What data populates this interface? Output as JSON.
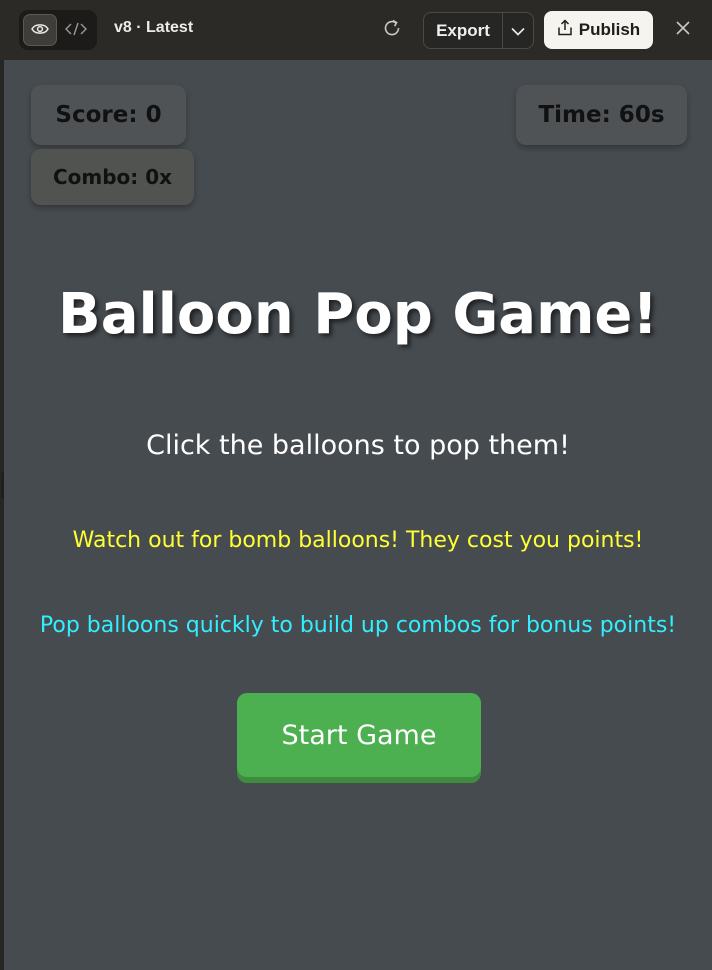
{
  "toolbar": {
    "version_label": "v8 · Latest",
    "export_label": "Export",
    "publish_label": "Publish",
    "icons": {
      "preview": "eye-icon",
      "code": "code-icon",
      "refresh": "refresh-icon",
      "export_menu": "chevron-down-icon",
      "publish": "share-icon",
      "close": "close-icon"
    }
  },
  "game": {
    "score_text": "Score: 0",
    "time_text": "Time: 60s",
    "combo_text": "Combo: 0x",
    "title": "Balloon Pop Game!",
    "instructions": [
      "Click the balloons to pop them!",
      "Watch out for bomb balloons! They cost you points!",
      "Pop balloons quickly to build up combos for bonus points!"
    ],
    "start_label": "Start Game",
    "colors": {
      "background": "#464b4f",
      "title": "#ffffff",
      "instruction_main": "#ffffff",
      "instruction_warning": "#ffff33",
      "instruction_tip": "#33eeff",
      "start_button": "#4caf50"
    }
  }
}
